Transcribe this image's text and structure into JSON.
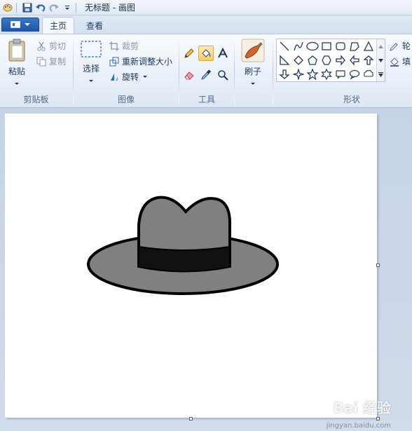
{
  "title": "无标题 - 画图",
  "tabs": {
    "home": "主页",
    "view": "查看"
  },
  "clipboard": {
    "paste": "粘贴",
    "cut": "剪切",
    "copy": "复制",
    "label": "剪贴板"
  },
  "image": {
    "select": "选择",
    "crop": "裁剪",
    "resize": "重新调整大小",
    "rotate": "旋转",
    "label": "图像"
  },
  "tools": {
    "label": "工具"
  },
  "brushes": {
    "label": "刷子"
  },
  "shapes": {
    "label": "形状",
    "outline": "轮",
    "fill": "填"
  },
  "watermark": {
    "brand": "Bai 经验",
    "url": "jingyan.baidu.com"
  },
  "colors": {
    "hat_fill": "#808080",
    "hat_band": "#111111",
    "hat_outline": "#000000",
    "accent": "#1c56a7"
  }
}
